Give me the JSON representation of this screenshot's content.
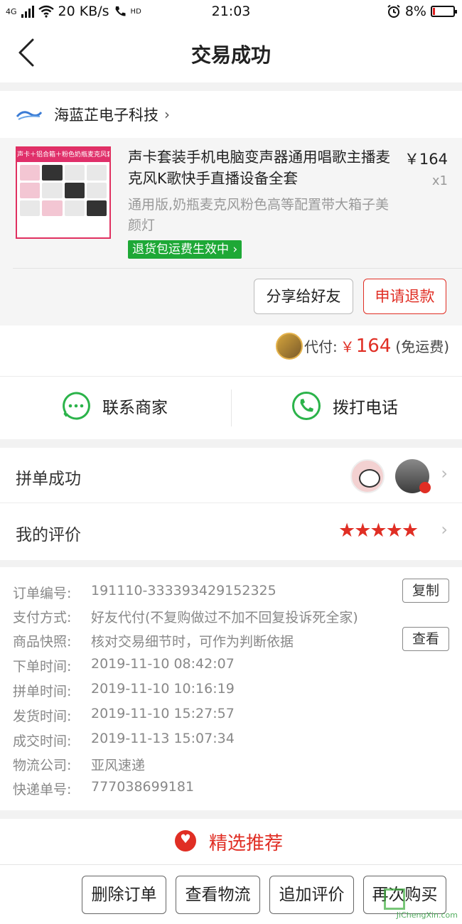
{
  "status_bar": {
    "network": "4G",
    "speed": "20 KB/s",
    "hd": "HD",
    "time": "21:03",
    "battery": "8%",
    "battery_level": 0.08
  },
  "header": {
    "title": "交易成功"
  },
  "shop": {
    "name": "海蓝芷电子科技",
    "arrow": "›"
  },
  "product": {
    "thumb_banner": "声卡＋铝合箱＋粉色奶瓶麦克风套装",
    "name": "声卡套装手机电脑变声器通用唱歌主播麦克风K歌快手直播设备全套",
    "price": "￥164",
    "qty": "x1",
    "spec": "通用版,奶瓶麦克风粉色高等配置带大箱子美颜灯",
    "return_tag": "退货包运费生效中",
    "share_button": "分享给好友",
    "refund_button": "申请退款"
  },
  "payment": {
    "label": "代付:",
    "currency": "￥",
    "amount": "164",
    "note": "(免运费)"
  },
  "contact": {
    "merchant": "联系商家",
    "call": "拨打电话"
  },
  "group": {
    "label": "拼单成功"
  },
  "review": {
    "label": "我的评价",
    "stars": "★★★★★",
    "rating": 5
  },
  "order_info": {
    "lines": [
      {
        "key": "订单编号:",
        "value": "191110-333393429152325"
      },
      {
        "key": "支付方式:",
        "value": "好友代付(不复购做过不加不回复投诉死全家)"
      },
      {
        "key": "商品快照:",
        "value": "核对交易细节时，可作为判断依据"
      },
      {
        "key": "下单时间:",
        "value": "2019-11-10 08:42:07"
      },
      {
        "key": "拼单时间:",
        "value": "2019-11-10 10:16:19"
      },
      {
        "key": "发货时间:",
        "value": "2019-11-10 15:27:57"
      },
      {
        "key": "成交时间:",
        "value": "2019-11-13 15:07:34"
      },
      {
        "key": "物流公司:",
        "value": "亚风速递"
      },
      {
        "key": "快递单号:",
        "value": "777038699181"
      }
    ],
    "copy_button": "复制",
    "view_button": "查看"
  },
  "recommend": {
    "title": "精选推荐"
  },
  "bottom_bar": {
    "delete": "删除订单",
    "logistics": "查看物流",
    "add_review": "追加评价",
    "rebuy": "再次购买"
  },
  "watermark": "JiChengXin.com",
  "colors": {
    "accent_red": "#e02e24",
    "green": "#1ea836",
    "wechat_green": "#2bb34a"
  }
}
